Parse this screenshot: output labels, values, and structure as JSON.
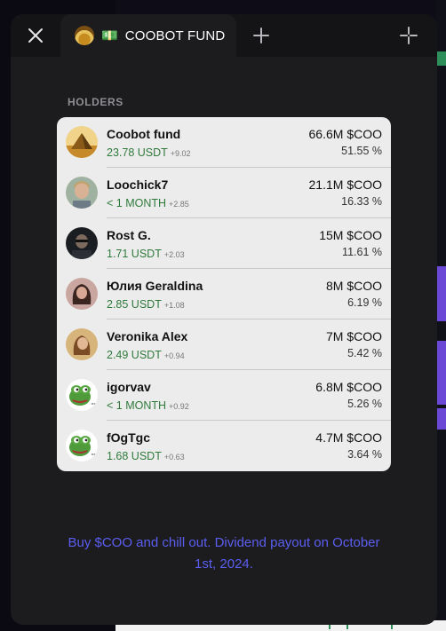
{
  "tabbar": {
    "tab_emoji": "💵",
    "tab_title": "COOBOT FUND"
  },
  "section_label": "HOLDERS",
  "holders": [
    {
      "name": "Coobot fund",
      "value": "23.78 USDT",
      "delta": "+9.02",
      "amount": "66.6M $COO",
      "percent": "51.55 %",
      "avatar": "pyramid"
    },
    {
      "name": "Loochick7",
      "value": "< 1 MONTH",
      "delta": "+2.85",
      "amount": "21.1M $COO",
      "percent": "16.33 %",
      "avatar": "photo-blonde"
    },
    {
      "name": "Rost G.",
      "value": "1.71 USDT",
      "delta": "+2.03",
      "amount": "15M $COO",
      "percent": "11.61 %",
      "avatar": "photo-dark"
    },
    {
      "name": "Юлия Geraldina",
      "value": "2.85 USDT",
      "delta": "+1.08",
      "amount": "8M $COO",
      "percent": "6.19 %",
      "avatar": "photo-brunette"
    },
    {
      "name": "Veronika Alex",
      "value": "2.49 USDT",
      "delta": "+0.94",
      "amount": "7M $COO",
      "percent": "5.42 %",
      "avatar": "photo-warm"
    },
    {
      "name": "igorvav",
      "value": "< 1 MONTH",
      "delta": "+0.92",
      "amount": "6.8M $COO",
      "percent": "5.26 %",
      "avatar": "pepe"
    },
    {
      "name": "fOgTgc",
      "value": "1.68 USDT",
      "delta": "+0.63",
      "amount": "4.7M $COO",
      "percent": "3.64 %",
      "avatar": "pepe"
    }
  ],
  "footer_note": "Buy $COO and chill out. Dividend payout on October 1st, 2024.",
  "colors": {
    "accent": "#5b5ef0",
    "positive": "#2f7a3b",
    "window_bg": "#1c1c1e",
    "card_bg": "#ececec"
  }
}
